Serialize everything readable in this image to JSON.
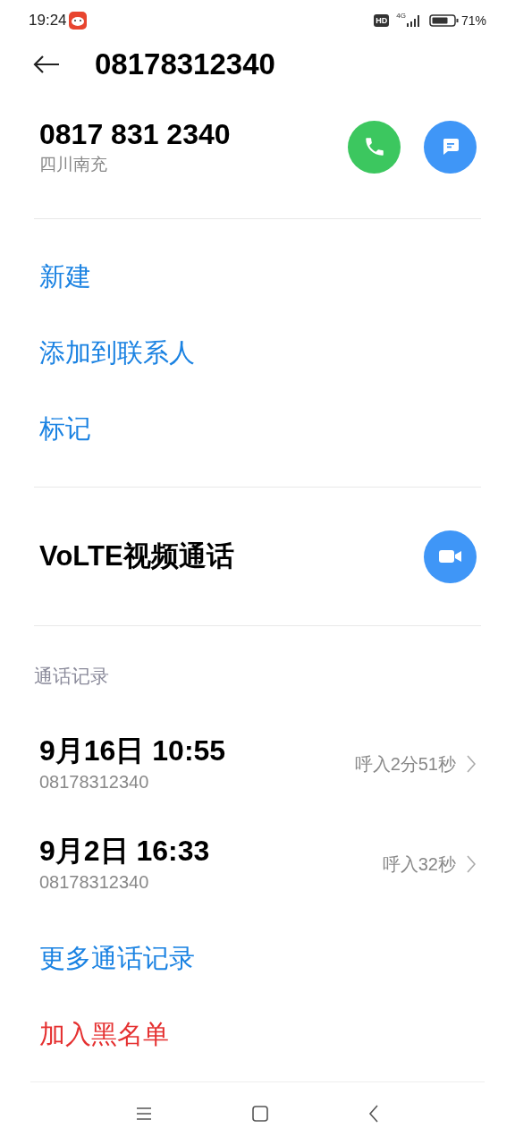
{
  "status_bar": {
    "time": "19:24",
    "hd": "HD",
    "network": "4G",
    "battery": "71%"
  },
  "header": {
    "title": "08178312340"
  },
  "contact": {
    "number": "0817 831 2340",
    "location": "四川南充"
  },
  "actions": [
    "新建",
    "添加到联系人",
    "标记"
  ],
  "video_call": {
    "label": "VoLTE视频通话"
  },
  "call_log": {
    "title": "通话记录",
    "calls": [
      {
        "time": "9月16日 10:55",
        "number": "08178312340",
        "detail": "呼入2分51秒"
      },
      {
        "time": "9月2日 16:33",
        "number": "08178312340",
        "detail": "呼入32秒"
      }
    ]
  },
  "more_calls": "更多通话记录",
  "blacklist": "加入黑名单"
}
